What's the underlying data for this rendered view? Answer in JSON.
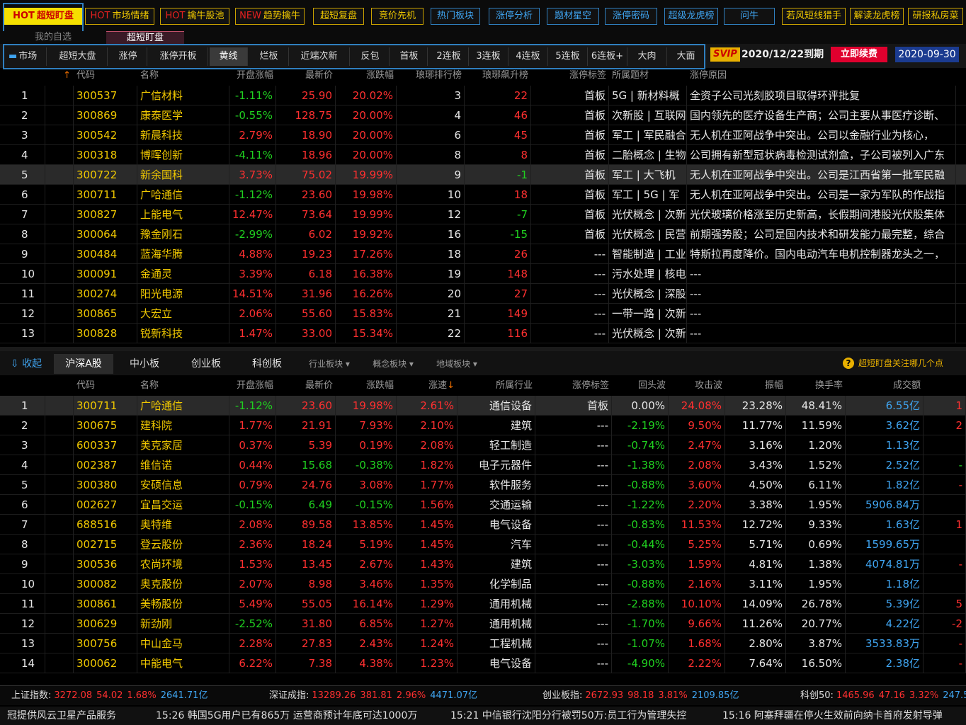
{
  "top_nav": [
    {
      "prefix": "HOT",
      "label": "超短盯盘",
      "active": true,
      "color": "yellow"
    },
    {
      "prefix": "HOT",
      "label": "市场情绪",
      "color": "yellow"
    },
    {
      "prefix": "HOT",
      "label": "擒牛股池",
      "color": "yellow"
    },
    {
      "prefix": "NEW",
      "label": "趋势擒牛",
      "color": "yellow"
    },
    {
      "prefix": "",
      "label": "超短复盘",
      "color": "yellow"
    },
    {
      "prefix": "",
      "label": "竞价先机",
      "color": "yellow"
    },
    {
      "prefix": "",
      "label": "热门板块",
      "color": "blue"
    },
    {
      "prefix": "",
      "label": "涨停分析",
      "color": "blue"
    },
    {
      "prefix": "",
      "label": "题材星空",
      "color": "blue"
    },
    {
      "prefix": "",
      "label": "涨停密码",
      "color": "blue"
    },
    {
      "prefix": "",
      "label": "超级龙虎榜",
      "color": "blue"
    },
    {
      "prefix": "",
      "label": "问牛",
      "color": "blue"
    },
    {
      "prefix": "",
      "label": "若风短线猎手",
      "color": "yellow"
    },
    {
      "prefix": "",
      "label": "解读龙虎榜",
      "color": "yellow"
    },
    {
      "prefix": "",
      "label": "研报私房菜",
      "color": "yellow"
    }
  ],
  "sub_tabs": [
    {
      "label": "我的自选"
    },
    {
      "label": "超短盯盘",
      "active": true
    }
  ],
  "market_tabs": [
    "市场",
    "超短大盘",
    "涨停",
    "涨停开板",
    "黄线",
    "烂板",
    "近端次新",
    "反包",
    "首板",
    "2连板",
    "3连板",
    "4连板",
    "5连板",
    "6连板+",
    "大肉",
    "大面"
  ],
  "market_active": 4,
  "svip": {
    "badge": "SVIP",
    "expire": "2020/12/22到期",
    "renew": "立即续费",
    "date": "2020-09-30"
  },
  "upper_headers": {
    "sort_icon": "↑",
    "code": "代码",
    "name": "名称",
    "open": "开盘涨幅",
    "price": "最新价",
    "change": "涨跌幅",
    "rank": "琅琊排行榜",
    "surge": "琅琊飙升榜",
    "tag": "涨停标签",
    "topic": "所属题材",
    "reason": "涨停原因"
  },
  "upper_rows": [
    {
      "n": "1",
      "code": "300537",
      "name": "广信材料",
      "open": "-1.11%",
      "price": "25.90",
      "change": "20.02%",
      "rank": "3",
      "surge": "22",
      "tag": "首板",
      "topic": "5G | 新材料概",
      "reason": "全资子公司光刻胶项目取得环评批复"
    },
    {
      "n": "2",
      "code": "300869",
      "name": "康泰医学",
      "open": "-0.55%",
      "price": "128.75",
      "change": "20.00%",
      "rank": "4",
      "surge": "46",
      "tag": "首板",
      "topic": "次新股 | 互联网",
      "reason": "国内领先的医疗设备生产商；公司主要从事医疗诊断、"
    },
    {
      "n": "3",
      "code": "300542",
      "name": "新晨科技",
      "open": "2.79%",
      "price": "18.90",
      "change": "20.00%",
      "rank": "6",
      "surge": "45",
      "tag": "首板",
      "topic": "军工 | 军民融合",
      "reason": "无人机在亚阿战争中突出。公司以金融行业为核心，"
    },
    {
      "n": "4",
      "code": "300318",
      "name": "博晖创新",
      "open": "-4.11%",
      "price": "18.96",
      "change": "20.00%",
      "rank": "8",
      "surge": "8",
      "tag": "首板",
      "topic": "二胎概念 | 生物",
      "reason": "公司拥有新型冠状病毒检测试剂盒，子公司被列入广东"
    },
    {
      "n": "5",
      "code": "300722",
      "name": "新余国科",
      "open": "3.73%",
      "price": "75.02",
      "change": "19.99%",
      "rank": "9",
      "surge": "-1",
      "tag": "首板",
      "topic": "军工 | 大飞机",
      "reason": "无人机在亚阿战争中突出。公司是江西省第一批军民融"
    },
    {
      "n": "6",
      "code": "300711",
      "name": "广哈通信",
      "open": "-1.12%",
      "price": "23.60",
      "change": "19.98%",
      "rank": "10",
      "surge": "18",
      "tag": "首板",
      "topic": "军工 | 5G | 军",
      "reason": "无人机在亚阿战争中突出。公司是一家为军队的作战指"
    },
    {
      "n": "7",
      "code": "300827",
      "name": "上能电气",
      "open": "12.47%",
      "price": "73.64",
      "change": "19.99%",
      "rank": "12",
      "surge": "-7",
      "tag": "首板",
      "topic": "光伏概念 | 次新",
      "reason": "光伏玻璃价格涨至历史新高，长假期间港股光伏股集体"
    },
    {
      "n": "8",
      "code": "300064",
      "name": "豫金刚石",
      "open": "-2.99%",
      "price": "6.02",
      "change": "19.92%",
      "rank": "16",
      "surge": "-15",
      "tag": "首板",
      "topic": "光伏概念 | 民营",
      "reason": "前期强势股；公司是国内技术和研发能力最完整，综合"
    },
    {
      "n": "9",
      "code": "300484",
      "name": "蓝海华腾",
      "open": "4.88%",
      "price": "19.23",
      "change": "17.26%",
      "rank": "18",
      "surge": "26",
      "tag": "---",
      "topic": "智能制造 | 工业",
      "reason": "特斯拉再度降价。国内电动汽车电机控制器龙头之一，"
    },
    {
      "n": "10",
      "code": "300091",
      "name": "金通灵",
      "open": "3.39%",
      "price": "6.18",
      "change": "16.38%",
      "rank": "19",
      "surge": "148",
      "tag": "---",
      "topic": "污水处理 | 核电",
      "reason": "---"
    },
    {
      "n": "11",
      "code": "300274",
      "name": "阳光电源",
      "open": "14.51%",
      "price": "31.96",
      "change": "16.26%",
      "rank": "20",
      "surge": "27",
      "tag": "---",
      "topic": "光伏概念 | 深股",
      "reason": "---"
    },
    {
      "n": "12",
      "code": "300865",
      "name": "大宏立",
      "open": "2.06%",
      "price": "55.60",
      "change": "15.83%",
      "rank": "21",
      "surge": "149",
      "tag": "---",
      "topic": "一带一路 | 次新",
      "reason": "---"
    },
    {
      "n": "13",
      "code": "300828",
      "name": "锐新科技",
      "open": "1.47%",
      "price": "33.00",
      "change": "15.34%",
      "rank": "22",
      "surge": "116",
      "tag": "---",
      "topic": "光伏概念 | 次新",
      "reason": "---"
    }
  ],
  "section_tabs": {
    "collapse": "收起",
    "tabs": [
      "沪深A股",
      "中小板",
      "创业板",
      "科创板"
    ],
    "dropdowns": [
      "行业板块",
      "概念板块",
      "地域板块"
    ],
    "tip": "超短盯盘关注哪几个点"
  },
  "lower_headers": {
    "code": "代码",
    "name": "名称",
    "open": "开盘涨幅",
    "price": "最新价",
    "change": "涨跌幅",
    "speed": "涨速",
    "sort_icon": "↓",
    "industry": "所属行业",
    "tag": "涨停标签",
    "pullback": "回头波",
    "attack": "攻击波",
    "amp": "振幅",
    "turnover": "换手率",
    "volume": "成交额"
  },
  "lower_rows": [
    {
      "n": "1",
      "code": "300711",
      "name": "广哈通信",
      "open": "-1.12%",
      "price": "23.60",
      "change": "19.98%",
      "speed": "2.61%",
      "industry": "通信设备",
      "tag": "首板",
      "pullback": "0.00%",
      "attack": "24.08%",
      "amp": "23.28%",
      "turnover": "48.41%",
      "volume": "6.55亿",
      "extra": "1"
    },
    {
      "n": "2",
      "code": "300675",
      "name": "建科院",
      "open": "1.77%",
      "price": "21.91",
      "change": "7.93%",
      "speed": "2.10%",
      "industry": "建筑",
      "tag": "---",
      "pullback": "-2.19%",
      "attack": "9.50%",
      "amp": "11.77%",
      "turnover": "11.59%",
      "volume": "3.62亿",
      "extra": "2"
    },
    {
      "n": "3",
      "code": "600337",
      "name": "美克家居",
      "open": "0.37%",
      "price": "5.39",
      "change": "0.19%",
      "speed": "2.08%",
      "industry": "轻工制造",
      "tag": "---",
      "pullback": "-0.74%",
      "attack": "2.47%",
      "amp": "3.16%",
      "turnover": "1.20%",
      "volume": "1.13亿",
      "extra": ""
    },
    {
      "n": "4",
      "code": "002387",
      "name": "维信诺",
      "open": "0.44%",
      "price": "15.68",
      "change": "-0.38%",
      "speed": "1.82%",
      "industry": "电子元器件",
      "tag": "---",
      "pullback": "-1.38%",
      "attack": "2.08%",
      "amp": "3.43%",
      "turnover": "1.52%",
      "volume": "2.52亿",
      "extra": "-"
    },
    {
      "n": "5",
      "code": "300380",
      "name": "安硕信息",
      "open": "0.79%",
      "price": "24.76",
      "change": "3.08%",
      "speed": "1.77%",
      "industry": "软件服务",
      "tag": "---",
      "pullback": "-0.88%",
      "attack": "3.60%",
      "amp": "4.50%",
      "turnover": "6.11%",
      "volume": "1.82亿",
      "extra": "-"
    },
    {
      "n": "6",
      "code": "002627",
      "name": "宜昌交运",
      "open": "-0.15%",
      "price": "6.49",
      "change": "-0.15%",
      "speed": "1.56%",
      "industry": "交通运输",
      "tag": "---",
      "pullback": "-1.22%",
      "attack": "2.20%",
      "amp": "3.38%",
      "turnover": "1.95%",
      "volume": "5906.84万",
      "extra": ""
    },
    {
      "n": "7",
      "code": "688516",
      "name": "奥特维",
      "open": "2.08%",
      "price": "89.58",
      "change": "13.85%",
      "speed": "1.45%",
      "industry": "电气设备",
      "tag": "---",
      "pullback": "-0.83%",
      "attack": "11.53%",
      "amp": "12.72%",
      "turnover": "9.33%",
      "volume": "1.63亿",
      "extra": "1"
    },
    {
      "n": "8",
      "code": "002715",
      "name": "登云股份",
      "open": "2.36%",
      "price": "18.24",
      "change": "5.19%",
      "speed": "1.45%",
      "industry": "汽车",
      "tag": "---",
      "pullback": "-0.44%",
      "attack": "5.25%",
      "amp": "5.71%",
      "turnover": "0.69%",
      "volume": "1599.65万",
      "extra": ""
    },
    {
      "n": "9",
      "code": "300536",
      "name": "农尚环境",
      "open": "1.53%",
      "price": "13.45",
      "change": "2.67%",
      "speed": "1.43%",
      "industry": "建筑",
      "tag": "---",
      "pullback": "-3.03%",
      "attack": "1.59%",
      "amp": "4.81%",
      "turnover": "1.38%",
      "volume": "4074.81万",
      "extra": "-"
    },
    {
      "n": "10",
      "code": "300082",
      "name": "奥克股份",
      "open": "2.07%",
      "price": "8.98",
      "change": "3.46%",
      "speed": "1.35%",
      "industry": "化学制品",
      "tag": "---",
      "pullback": "-0.88%",
      "attack": "2.16%",
      "amp": "3.11%",
      "turnover": "1.95%",
      "volume": "1.18亿",
      "extra": ""
    },
    {
      "n": "11",
      "code": "300861",
      "name": "美畅股份",
      "open": "5.49%",
      "price": "55.05",
      "change": "16.14%",
      "speed": "1.29%",
      "industry": "通用机械",
      "tag": "---",
      "pullback": "-2.88%",
      "attack": "10.10%",
      "amp": "14.09%",
      "turnover": "26.78%",
      "volume": "5.39亿",
      "extra": "5"
    },
    {
      "n": "12",
      "code": "300629",
      "name": "新劲刚",
      "open": "-2.52%",
      "price": "31.80",
      "change": "6.85%",
      "speed": "1.27%",
      "industry": "通用机械",
      "tag": "---",
      "pullback": "-1.70%",
      "attack": "9.66%",
      "amp": "11.26%",
      "turnover": "20.77%",
      "volume": "4.22亿",
      "extra": "-2"
    },
    {
      "n": "13",
      "code": "300756",
      "name": "中山金马",
      "open": "2.28%",
      "price": "27.83",
      "change": "2.43%",
      "speed": "1.24%",
      "industry": "工程机械",
      "tag": "---",
      "pullback": "-1.07%",
      "attack": "1.68%",
      "amp": "2.80%",
      "turnover": "3.87%",
      "volume": "3533.83万",
      "extra": "-"
    },
    {
      "n": "14",
      "code": "300062",
      "name": "中能电气",
      "open": "6.22%",
      "price": "7.38",
      "change": "4.38%",
      "speed": "1.23%",
      "industry": "电气设备",
      "tag": "---",
      "pullback": "-4.90%",
      "attack": "2.22%",
      "amp": "7.64%",
      "turnover": "16.50%",
      "volume": "2.38亿",
      "extra": "-"
    }
  ],
  "indices": [
    {
      "label": "上证指数:",
      "v1": "3272.08",
      "v2": "54.02",
      "v3": "1.68%",
      "v4": "2641.71亿"
    },
    {
      "label": "深证成指:",
      "v1": "13289.26",
      "v2": "381.81",
      "v3": "2.96%",
      "v4": "4471.07亿"
    },
    {
      "label": "创业板指:",
      "v1": "2672.93",
      "v2": "98.18",
      "v3": "3.81%",
      "v4": "2109.85亿"
    },
    {
      "label": "科创50:",
      "v1": "1465.96",
      "v2": "47.16",
      "v3": "3.32%",
      "v4": "247.5"
    }
  ],
  "news": [
    "冠提供风云卫星产品服务",
    "15:26 韩国5G用户已有865万 运营商预计年底可达1000万",
    "15:21 中信银行沈阳分行被罚50万:员工行为管理失控",
    "15:16 阿塞拜疆在停火生效前向纳卡首府发射导弹"
  ],
  "colors": {
    "up": "#ff3030",
    "down": "#20d020",
    "code": "#f0c800",
    "accent": "#2f7fbf",
    "hot": "#f5e000"
  }
}
